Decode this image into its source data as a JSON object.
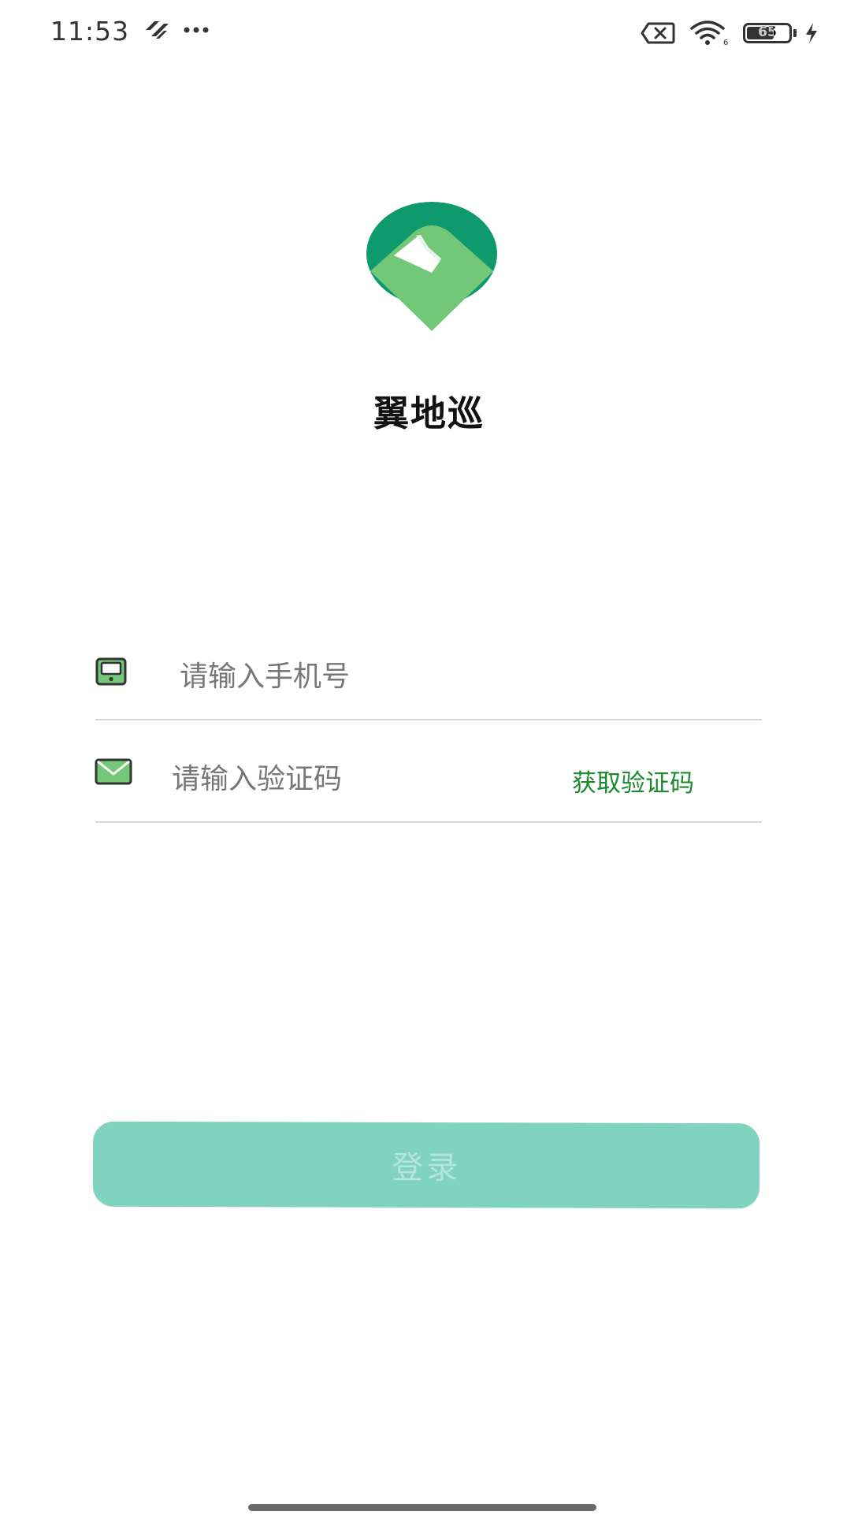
{
  "status_bar": {
    "time": "11:53",
    "battery_level": "65",
    "battery_percent": 65,
    "icons": [
      "app-notification-icon",
      "more-dots-icon",
      "no-sim-icon",
      "wifi-icon",
      "battery-icon",
      "charging-icon"
    ]
  },
  "app": {
    "name": "翼地巡",
    "logo_colors": {
      "dark": "#0e9a6d",
      "light": "#73c778"
    }
  },
  "form": {
    "phone_placeholder": "请输入手机号",
    "code_placeholder": "请输入验证码",
    "get_code_label": "获取验证码"
  },
  "login": {
    "label": "登录",
    "color": "#80d3bf"
  }
}
